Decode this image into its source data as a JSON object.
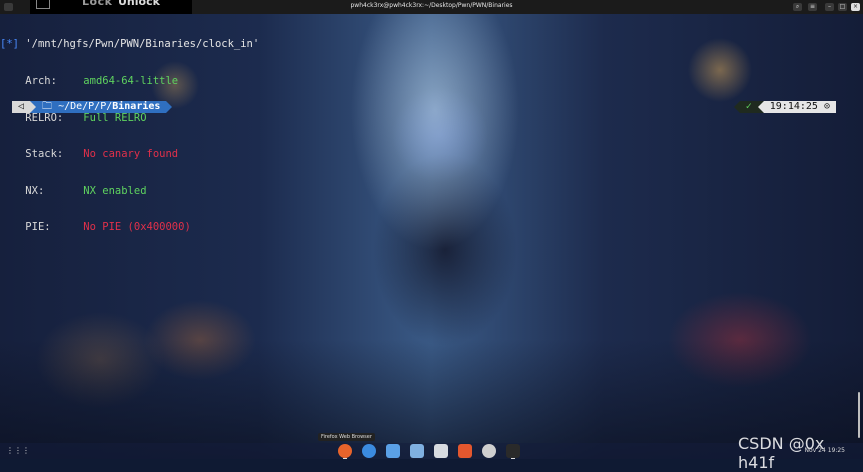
{
  "window": {
    "title": "pwh4ck3rx@pwh4ck3rx:~/Desktop/Pwn/PWN/Binaries"
  },
  "lock_overlay": {
    "lock_label": "Lock",
    "unlock_label": "Unlock"
  },
  "terminal": {
    "checksec": {
      "prefix": "[*]",
      "path": "'/mnt/hgfs/Pwn/PWN/Binaries/clock_in'",
      "rows": [
        {
          "key": "Arch:",
          "value": "amd64-64-little",
          "status": "green"
        },
        {
          "key": "RELRO:",
          "value": "Full RELRO",
          "status": "green"
        },
        {
          "key": "Stack:",
          "value": "No canary found",
          "status": "red"
        },
        {
          "key": "NX:",
          "value": "NX enabled",
          "status": "green"
        },
        {
          "key": "PIE:",
          "value": "No PIE (0x400000)",
          "status": "red"
        }
      ]
    },
    "prompt": {
      "back_icon": "◁",
      "folder_icon": "folder-icon",
      "path_prefix": "~/De/P/P/",
      "path_current": "Binaries",
      "ok_mark": "✓",
      "time": "19:14:25",
      "clock_icon": "⊙"
    }
  },
  "tooltip": {
    "text": "Firefox Web Browser"
  },
  "dock": {
    "apps": [
      {
        "name": "firefox",
        "color": "#e8642b"
      },
      {
        "name": "web-browser",
        "color": "#3b8be0"
      },
      {
        "name": "files",
        "color": "#5aa0e6"
      },
      {
        "name": "screenshot",
        "color": "#7fb0e0"
      },
      {
        "name": "text-editor",
        "color": "#d7dbe0"
      },
      {
        "name": "app-store",
        "color": "#e4572e"
      },
      {
        "name": "help",
        "color": "#cfcfcf"
      },
      {
        "name": "terminal",
        "color": "#2a2a2a"
      }
    ],
    "tray_text": "Nov 24 19:25"
  },
  "watermark": {
    "text": "CSDN @0x h41f"
  },
  "colors": {
    "green": "#5fd35f",
    "red": "#e0304a",
    "path_blue": "#2f6fc0"
  }
}
